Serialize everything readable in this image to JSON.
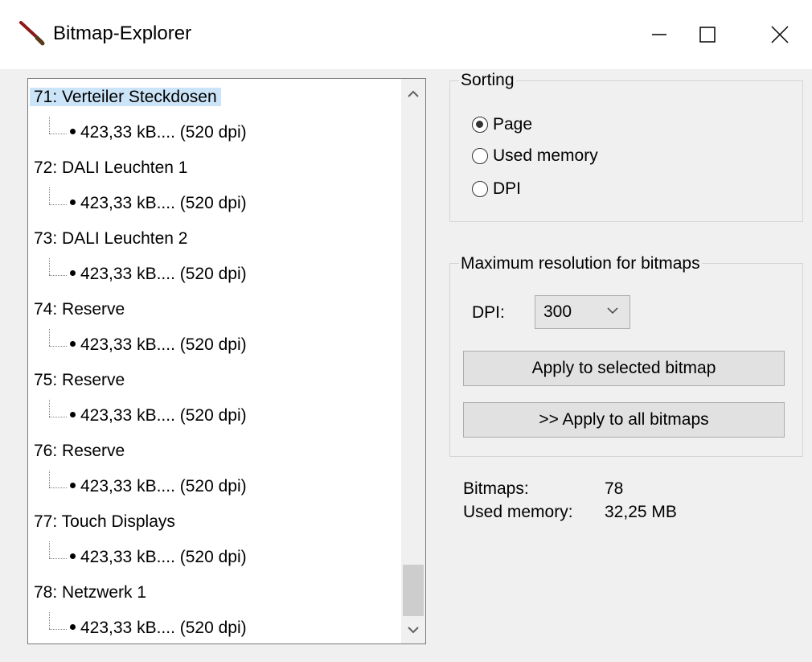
{
  "window": {
    "title": "Bitmap-Explorer",
    "icon": "brush-icon",
    "controls": [
      "minimize-icon",
      "maximize-icon",
      "close-icon"
    ]
  },
  "tree": {
    "items": [
      {
        "label": "71: Verteiler Steckdosen",
        "detail": "423,33 kB.... (520 dpi)",
        "selected": true
      },
      {
        "label": "72: DALI Leuchten 1",
        "detail": "423,33 kB.... (520 dpi)",
        "selected": false
      },
      {
        "label": "73: DALI Leuchten 2",
        "detail": "423,33 kB.... (520 dpi)",
        "selected": false
      },
      {
        "label": "74: Reserve",
        "detail": "423,33 kB.... (520 dpi)",
        "selected": false
      },
      {
        "label": "75: Reserve",
        "detail": "423,33 kB.... (520 dpi)",
        "selected": false
      },
      {
        "label": "76: Reserve",
        "detail": "423,33 kB.... (520 dpi)",
        "selected": false
      },
      {
        "label": "77: Touch Displays",
        "detail": "423,33 kB.... (520 dpi)",
        "selected": false
      },
      {
        "label": "78: Netzwerk 1",
        "detail": "423,33 kB.... (520 dpi)",
        "selected": false
      }
    ]
  },
  "sorting": {
    "title": "Sorting",
    "options": [
      {
        "label": "Page",
        "checked": true
      },
      {
        "label": "Used memory",
        "checked": false
      },
      {
        "label": "DPI",
        "checked": false
      }
    ]
  },
  "resolution": {
    "title": "Maximum resolution for bitmaps",
    "dpi_label": "DPI:",
    "dpi_value": "300",
    "apply_selected": "Apply to selected bitmap",
    "apply_all": ">>  Apply to all bitmaps"
  },
  "stats": {
    "bitmaps_label": "Bitmaps:",
    "bitmaps_value": "78",
    "memory_label": "Used memory:",
    "memory_value": "32,25 MB"
  },
  "colors": {
    "selection": "#cce4f7",
    "window_bg": "#f0f0f0",
    "button_bg": "#e1e1e1"
  }
}
